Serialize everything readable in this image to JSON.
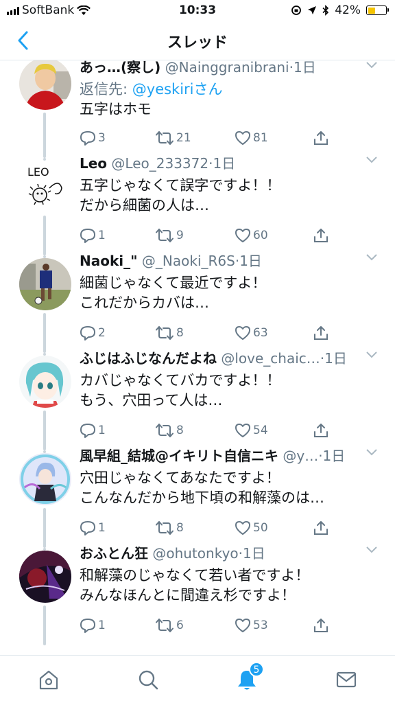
{
  "status_bar": {
    "carrier": "SoftBank",
    "time": "10:33",
    "battery": "42%",
    "battery_level": 0.42,
    "battery_color": "#f5c400"
  },
  "nav": {
    "title": "スレッド",
    "back_icon": "chevron-left-icon",
    "accent_color": "#1da1f2"
  },
  "tweets": [
    {
      "name": "あっ…(察し)",
      "handle": "@Nainggranibrani",
      "time": "·1日",
      "reply_prefix": "返信先: ",
      "reply_to": "@yeskiriさん",
      "lines": [
        "五字はホモ"
      ],
      "replies": "3",
      "retweets": "21",
      "likes": "81"
    },
    {
      "name": "Leo",
      "handle": "@Leo_233372",
      "time": "·1日",
      "lines": [
        "五字じゃなくて誤字ですよ！！",
        "だから細菌の人は…"
      ],
      "replies": "1",
      "retweets": "9",
      "likes": "60",
      "avatar_text": "LEO"
    },
    {
      "name": "Naoki_\"",
      "handle": "@_Naoki_R6S",
      "time": "·1日",
      "lines": [
        "細菌じゃなくて最近ですよ！",
        "これだからカバは…"
      ],
      "replies": "2",
      "retweets": "8",
      "likes": "63"
    },
    {
      "name": "ふじはふじなんだよね",
      "handle": "@love_chaic…",
      "time": "·1日",
      "lines": [
        "カバじゃなくてバカですよ！！",
        "もう、穴田って人は…"
      ],
      "replies": "1",
      "retweets": "8",
      "likes": "54"
    },
    {
      "name": "風早組_結城@イキリト自信ニキ",
      "handle": "@y…",
      "time": "·1日",
      "lines": [
        "穴田じゃなくてあなたですよ！",
        "こんなんだから地下頃の和解藻のは…"
      ],
      "replies": "1",
      "retweets": "8",
      "likes": "50"
    },
    {
      "name": "おふとん狂",
      "handle": "@ohutonkyo",
      "time": "·1日",
      "lines": [
        "和解藻のじゃなくて若い者ですよ！",
        "みんなほんとに間違え杉ですよ！"
      ],
      "replies": "1",
      "retweets": "6",
      "likes": "53"
    }
  ],
  "tabbar": {
    "items": [
      "home-icon",
      "search-icon",
      "notifications-icon",
      "messages-icon"
    ],
    "notification_badge": "5"
  }
}
